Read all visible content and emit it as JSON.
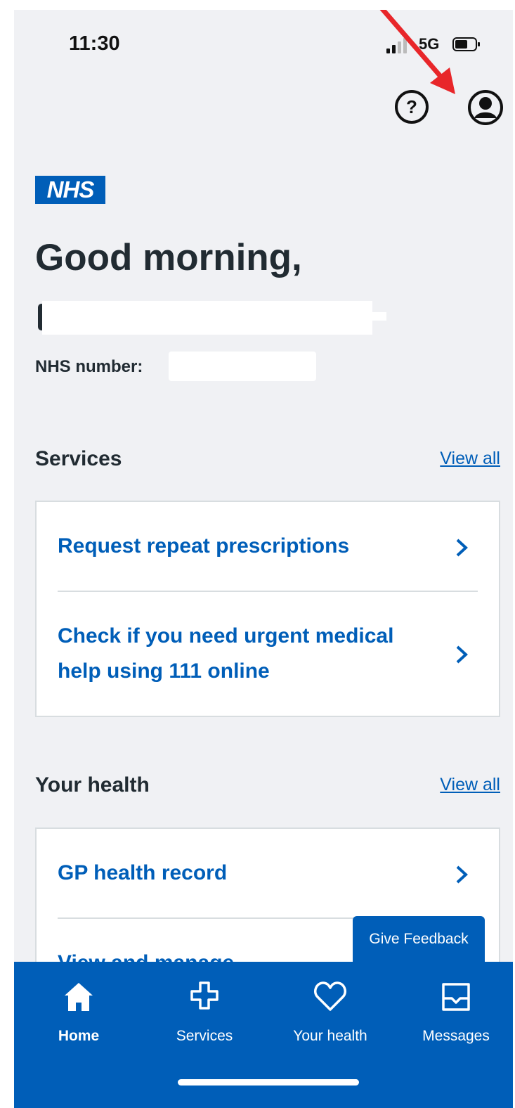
{
  "status_bar": {
    "time": "11:30",
    "network": "5G"
  },
  "header": {
    "help_icon": "question-circle",
    "account_icon": "user-circle"
  },
  "brand": {
    "logo_text": "NHS",
    "color": "#005eb8"
  },
  "greeting": {
    "text": "Good morning,",
    "nhs_number_label": "NHS number:"
  },
  "services": {
    "title": "Services",
    "view_all": "View all",
    "items": [
      {
        "label": "Request repeat prescriptions"
      },
      {
        "label": "Check if you need urgent medical help using 111 online"
      }
    ]
  },
  "your_health": {
    "title": "Your health",
    "view_all": "View all",
    "items": [
      {
        "label": "GP health record"
      },
      {
        "label": "View and manage"
      }
    ]
  },
  "feedback": {
    "label": "Give Feedback"
  },
  "bottom_nav": {
    "items": [
      {
        "label": "Home",
        "icon": "home-icon",
        "active": true
      },
      {
        "label": "Services",
        "icon": "plus-icon",
        "active": false
      },
      {
        "label": "Your health",
        "icon": "heart-icon",
        "active": false
      },
      {
        "label": "Messages",
        "icon": "envelope-icon",
        "active": false
      }
    ]
  },
  "colors": {
    "background": "#f0f1f4",
    "accent": "#005eb8",
    "text": "#212b32",
    "annotation": "#e8262a"
  }
}
